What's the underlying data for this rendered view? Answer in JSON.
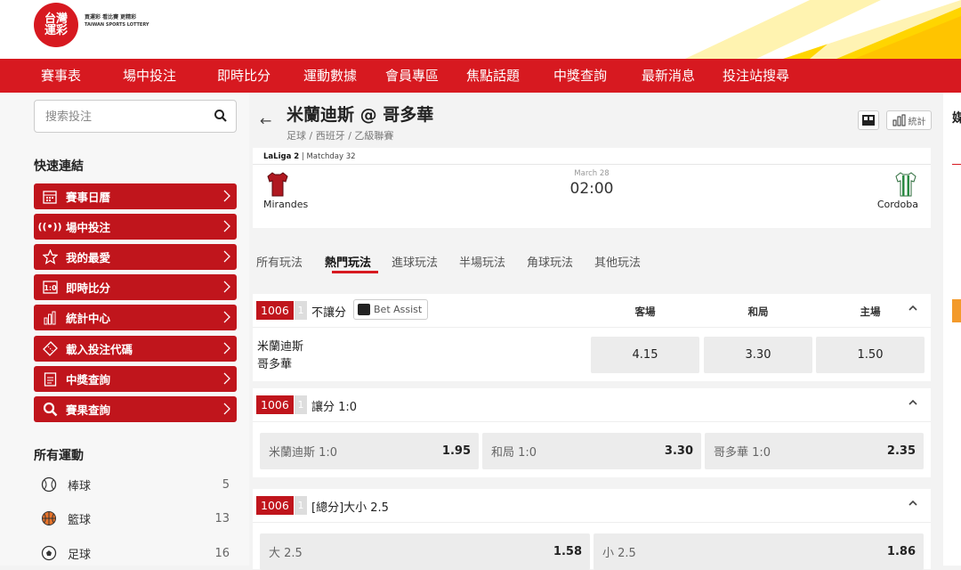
{
  "brand": {
    "logo_text": "台灣運彩",
    "slogan": "買運彩 看比賽 更精彩",
    "sub": "TAIWAN SPORTS LOTTERY"
  },
  "nav": [
    "賽事表",
    "場中投注",
    "即時比分",
    "運動數據",
    "會員專區",
    "焦點話題",
    "中獎查詢",
    "最新消息",
    "投注站搜尋"
  ],
  "sidebar": {
    "search_placeholder": "搜索投注",
    "quick_title": "快速連結",
    "quick_links": [
      "賽事日曆",
      "場中投注",
      "我的最愛",
      "即時比分",
      "統計中心",
      "載入投注代碼",
      "中獎查詢",
      "賽果查詢"
    ],
    "sports_title": "所有運動",
    "sports": [
      {
        "name": "棒球",
        "count": "5"
      },
      {
        "name": "籃球",
        "count": "13"
      },
      {
        "name": "足球",
        "count": "16"
      }
    ]
  },
  "match": {
    "title": "米蘭迪斯 @ 哥多華",
    "breadcrumb": "足球 / 西班牙 / 乙級聯賽",
    "stats_label": "統計",
    "league": "LaLiga 2",
    "matchday": "| Matchday 32",
    "date": "March 28",
    "time": "02:00",
    "home_team": "Mirandes",
    "away_team": "Cordoba"
  },
  "tabs": [
    "所有玩法",
    "熱門玩法",
    "進球玩法",
    "半場玩法",
    "角球玩法",
    "其他玩法"
  ],
  "markets": [
    {
      "code": "1006",
      "num": "1",
      "name": "不讓分",
      "assist": "Bet Assist",
      "cols": [
        "客場",
        "和局",
        "主場"
      ],
      "teams": [
        "米蘭迪斯",
        "哥多華"
      ],
      "odds": [
        "4.15",
        "3.30",
        "1.50"
      ]
    },
    {
      "code": "1006",
      "num": "1",
      "name": "讓分 1:0",
      "options": [
        {
          "label": "米蘭迪斯 1:0",
          "odd": "1.95"
        },
        {
          "label": "和局 1:0",
          "odd": "3.30"
        },
        {
          "label": "哥多華 1:0",
          "odd": "2.35"
        }
      ]
    },
    {
      "code": "1006",
      "num": "1",
      "name": "[總分]大小 2.5",
      "options": [
        {
          "label": "大 2.5",
          "odd": "1.58"
        },
        {
          "label": "小 2.5",
          "odd": "1.86"
        }
      ]
    }
  ],
  "right_panel": {
    "label": "媒"
  },
  "colors": {
    "brand_red": "#d71920",
    "dark_red": "#c0151c",
    "yellow": "#ffd500"
  }
}
